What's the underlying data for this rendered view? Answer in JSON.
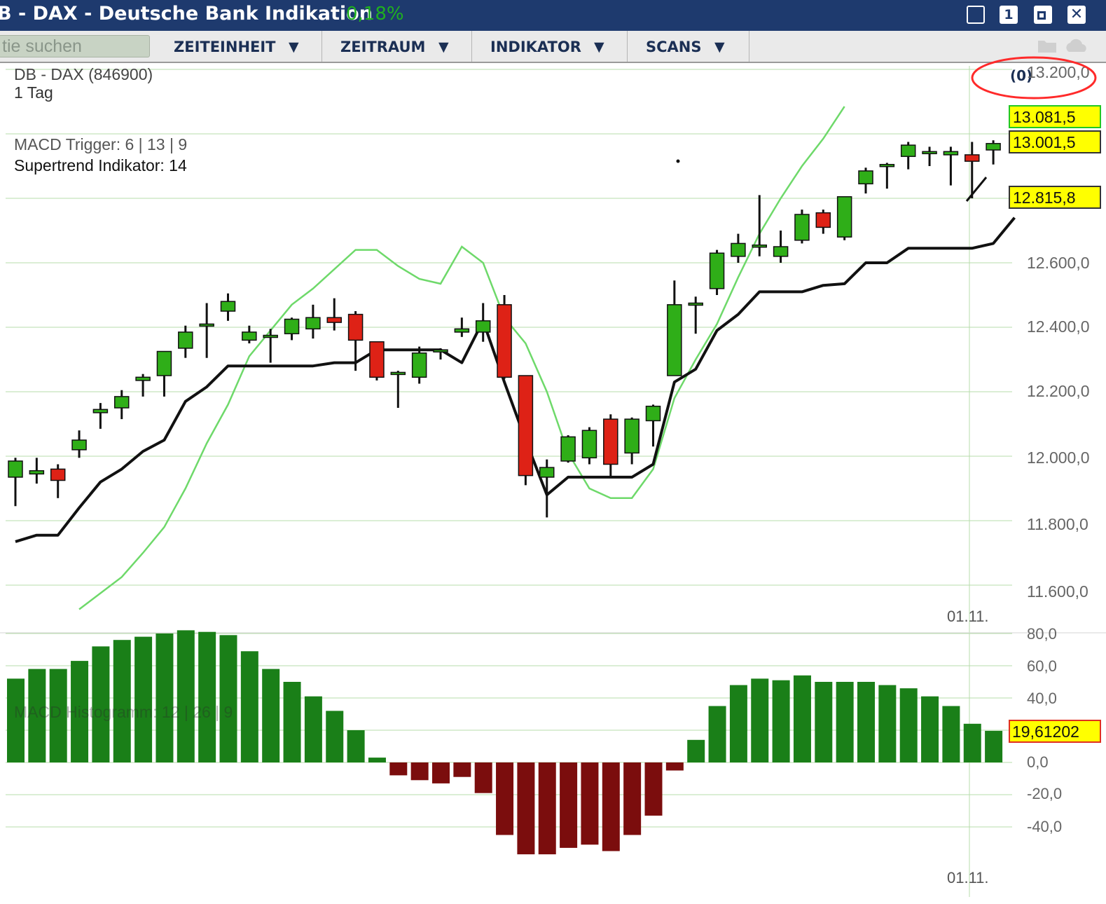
{
  "window": {
    "title": "B - DAX - Deutsche Bank Indikation",
    "change": "0,18%",
    "buttons": [
      "minimize",
      "1",
      "restore",
      "close"
    ],
    "badge": "1"
  },
  "toolbar": {
    "search_placeholder": "tie suchen",
    "menus": [
      "ZEITEINHEIT",
      "ZEITRAUM",
      "INDIKATOR",
      "SCANS"
    ],
    "count": "(0)"
  },
  "colors": {
    "up": "#2fae18",
    "down": "#de2216",
    "supertrend": "#111111",
    "macd_line": "#6ed96a",
    "hist_pos": "#1a7f18",
    "hist_neg": "#7b0d0d",
    "grid": "#b7dcab",
    "highlight": "#ff2a2a"
  },
  "chart_data": [
    {
      "type": "candlestick",
      "title": "DB - DAX (846900)",
      "subtitle": "1 Tag",
      "indicators": [
        "MACD Trigger: 6 | 13 | 9",
        "Supertrend Indikator: 14"
      ],
      "y_ticks": [
        "13.200,0",
        "12.600,0",
        "12.400,0",
        "12.200,0",
        "12.000,0",
        "11.800,0",
        "11.600,0"
      ],
      "x_label": "01.11.",
      "price_tags": [
        {
          "label": "13.081,5",
          "kind": "green"
        },
        {
          "label": "13.001,5",
          "kind": "yellow"
        },
        {
          "label": "12.815,8",
          "kind": "yellow"
        }
      ],
      "candles": [
        {
          "o": 11935,
          "h": 11995,
          "l": 11845,
          "c": 11985
        },
        {
          "o": 11945,
          "h": 11995,
          "l": 11915,
          "c": 11955
        },
        {
          "o": 11960,
          "h": 11975,
          "l": 11870,
          "c": 11925
        },
        {
          "o": 12020,
          "h": 12080,
          "l": 11995,
          "c": 12050
        },
        {
          "o": 12135,
          "h": 12165,
          "l": 12085,
          "c": 12145
        },
        {
          "o": 12150,
          "h": 12205,
          "l": 12115,
          "c": 12185
        },
        {
          "o": 12235,
          "h": 12255,
          "l": 12185,
          "c": 12245
        },
        {
          "o": 12250,
          "h": 12310,
          "l": 12185,
          "c": 12325
        },
        {
          "o": 12335,
          "h": 12405,
          "l": 12305,
          "c": 12385
        },
        {
          "o": 12405,
          "h": 12475,
          "l": 12305,
          "c": 12410
        },
        {
          "o": 12450,
          "h": 12505,
          "l": 12420,
          "c": 12480
        },
        {
          "o": 12360,
          "h": 12405,
          "l": 12350,
          "c": 12385
        },
        {
          "o": 12370,
          "h": 12395,
          "l": 12290,
          "c": 12375
        },
        {
          "o": 12380,
          "h": 12430,
          "l": 12360,
          "c": 12425
        },
        {
          "o": 12395,
          "h": 12470,
          "l": 12365,
          "c": 12430
        },
        {
          "o": 12430,
          "h": 12490,
          "l": 12390,
          "c": 12415
        },
        {
          "o": 12440,
          "h": 12450,
          "l": 12265,
          "c": 12360
        },
        {
          "o": 12355,
          "h": 12355,
          "l": 12235,
          "c": 12245
        },
        {
          "o": 12260,
          "h": 12265,
          "l": 12150,
          "c": 12260
        },
        {
          "o": 12245,
          "h": 12340,
          "l": 12225,
          "c": 12320
        },
        {
          "o": 12330,
          "h": 12335,
          "l": 12300,
          "c": 12330
        },
        {
          "o": 12385,
          "h": 12430,
          "l": 12370,
          "c": 12395
        },
        {
          "o": 12385,
          "h": 12475,
          "l": 12355,
          "c": 12420
        },
        {
          "o": 12470,
          "h": 12500,
          "l": 12240,
          "c": 12245
        },
        {
          "o": 12250,
          "h": 12250,
          "l": 11910,
          "c": 11940
        },
        {
          "o": 11935,
          "h": 11990,
          "l": 11810,
          "c": 11965
        },
        {
          "o": 11985,
          "h": 12065,
          "l": 11980,
          "c": 12060
        },
        {
          "o": 11995,
          "h": 12090,
          "l": 11975,
          "c": 12080
        },
        {
          "o": 12115,
          "h": 12130,
          "l": 11935,
          "c": 11975
        },
        {
          "o": 12010,
          "h": 12120,
          "l": 11975,
          "c": 12115
        },
        {
          "o": 12110,
          "h": 12160,
          "l": 12030,
          "c": 12155
        },
        {
          "o": 12250,
          "h": 12545,
          "l": 12250,
          "c": 12470
        },
        {
          "o": 12475,
          "h": 12495,
          "l": 12380,
          "c": 12475
        },
        {
          "o": 12520,
          "h": 12640,
          "l": 12500,
          "c": 12630
        },
        {
          "o": 12620,
          "h": 12690,
          "l": 12600,
          "c": 12660
        },
        {
          "o": 12650,
          "h": 12810,
          "l": 12620,
          "c": 12655
        },
        {
          "o": 12620,
          "h": 12700,
          "l": 12600,
          "c": 12650
        },
        {
          "o": 12670,
          "h": 12765,
          "l": 12660,
          "c": 12750
        },
        {
          "o": 12755,
          "h": 12765,
          "l": 12690,
          "c": 12710
        },
        {
          "o": 12680,
          "h": 12800,
          "l": 12670,
          "c": 12805
        },
        {
          "o": 12845,
          "h": 12895,
          "l": 12815,
          "c": 12885
        },
        {
          "o": 12900,
          "h": 12910,
          "l": 12830,
          "c": 12905
        },
        {
          "o": 12930,
          "h": 12975,
          "l": 12890,
          "c": 12965
        },
        {
          "o": 12940,
          "h": 12960,
          "l": 12900,
          "c": 12945
        },
        {
          "o": 12935,
          "h": 12960,
          "l": 12840,
          "c": 12945
        },
        {
          "o": 12935,
          "h": 12975,
          "l": 12800,
          "c": 12915
        },
        {
          "o": 12950,
          "h": 12980,
          "l": 12905,
          "c": 12970
        }
      ],
      "supertrend": [
        11735,
        11755,
        11755,
        11840,
        11920,
        11960,
        12015,
        12050,
        12170,
        12215,
        12280,
        12280,
        12280,
        12280,
        12280,
        12290,
        12290,
        12330,
        12330,
        12330,
        12330,
        12290,
        12420,
        12230,
        12050,
        11880,
        11935,
        11935,
        11935,
        11935,
        11975,
        12230,
        12270,
        12390,
        12440,
        12510,
        12510,
        12510,
        12530,
        12535,
        12600,
        12600,
        12645,
        12645,
        12645,
        12645,
        12660,
        12740
      ],
      "macd_line": [
        11525,
        11575,
        11625,
        11700,
        11780,
        11900,
        12040,
        12160,
        12310,
        12390,
        12470,
        12520,
        12580,
        12640,
        12640,
        12590,
        12550,
        12535,
        12650,
        12600,
        12430,
        12350,
        12200,
        12010,
        11900,
        11870,
        11870,
        11960,
        12180,
        12300,
        12410,
        12555,
        12690,
        12800,
        12900,
        12985,
        13085
      ]
    },
    {
      "type": "bar",
      "title": "MACD Histogramm: 12 | 26 | 9",
      "y_ticks": [
        "80,0",
        "60,0",
        "40,0",
        "0,0",
        "-20,0",
        "-40,0"
      ],
      "ylim": [
        -60,
        85
      ],
      "x_label": "01.11.",
      "value_tag": "19,61202",
      "values": [
        52,
        58,
        58,
        63,
        72,
        76,
        78,
        80,
        82,
        81,
        79,
        69,
        58,
        50,
        41,
        32,
        20,
        3,
        -8,
        -11,
        -13,
        -9,
        -19,
        -45,
        -57,
        -57,
        -53,
        -51,
        -55,
        -45,
        -33,
        -5,
        14,
        35,
        48,
        52,
        51,
        54,
        50,
        50,
        50,
        48,
        46,
        41,
        35,
        24,
        19.6
      ]
    }
  ]
}
